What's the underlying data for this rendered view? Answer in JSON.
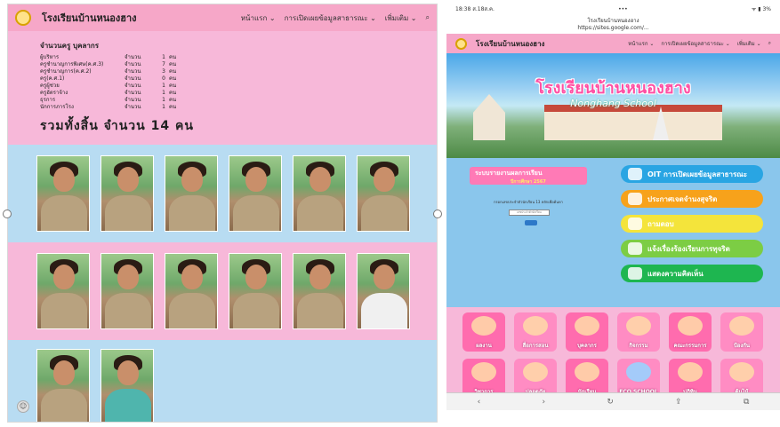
{
  "left": {
    "nav": {
      "title": "โรงเรียนบ้านหนองฮาง",
      "menu": [
        "หน้าแรก",
        "การเปิดเผยข้อมูลสาธารณะ",
        "เพิ่มเติม"
      ]
    },
    "staff": {
      "caption": "จำนวนครู บุคลากร",
      "rows": [
        {
          "role": "ผู้บริหาร",
          "label": "จำนวน",
          "count": "1",
          "unit": "คน"
        },
        {
          "role": "ครูชำนาญการพิเศษ(ค.ศ.3)",
          "label": "จำนวน",
          "count": "7",
          "unit": "คน"
        },
        {
          "role": "ครูชำนาญการ(ค.ศ.2)",
          "label": "จำนวน",
          "count": "3",
          "unit": "คน"
        },
        {
          "role": "ครู(ค.ศ.1)",
          "label": "จำนวน",
          "count": "0",
          "unit": "คน"
        },
        {
          "role": "ครูผู้ช่วย",
          "label": "จำนวน",
          "count": "1",
          "unit": "คน"
        },
        {
          "role": "ครูอัตราจ้าง",
          "label": "จำนวน",
          "count": "1",
          "unit": "คน"
        },
        {
          "role": "ธุรการ",
          "label": "จำนวน",
          "count": "1",
          "unit": "คน"
        },
        {
          "role": "นักการภารโรง",
          "label": "จำนวน",
          "count": "1",
          "unit": "คน"
        }
      ],
      "total": "รวมทั้งสิ้น  จำนวน  14  คน"
    },
    "photo_rows": [
      [
        "tan",
        "tan",
        "tan",
        "tan",
        "tan",
        "tan"
      ],
      [
        "tan",
        "tan",
        "tan",
        "tan",
        "tan",
        "white"
      ],
      [
        "tan",
        "teal"
      ]
    ]
  },
  "right": {
    "status": {
      "time": "18:38  ส.18ส.ค.",
      "dots": "•••",
      "battery": "ᯤ ▮ 3%"
    },
    "url": {
      "site": "โรงเรียนบ้านหนองฮาง",
      "address": "https://sites.google.com/..."
    },
    "nav": {
      "title": "โรงเรียนบ้านหนองฮาง",
      "menu": [
        "หน้าแรก",
        "การเปิดเผยข้อมูลสาธารณะ",
        "เพิ่มเติม"
      ]
    },
    "banner": {
      "title": "โรงเรียนบ้านหนองฮาง",
      "subtitle": "Nonghang School"
    },
    "report": {
      "title": "ระบบรายงานผลการเรียน",
      "sub": "ปีการศึกษา 2567"
    },
    "search_note": "กรอกเลขประจำตัวนักเรียน 13 หลักเพื่อค้นหา",
    "search_placeholder": "เลขประจำตัวนักเรียน",
    "pills": [
      {
        "label": "OIT การเปิดเผยข้อมูลสาธารณะ",
        "icon": "oit-icon"
      },
      {
        "label": "ประกาศเจตจำนงสุจริต",
        "icon": "announce-icon"
      },
      {
        "label": "ถามตอบ",
        "icon": "qa-icon"
      },
      {
        "label": "แจ้งเรื่องร้องเรียนการทุจริต",
        "icon": "report-icon"
      },
      {
        "label": "แสดงความคิดเห็น",
        "icon": "comment-icon"
      }
    ],
    "tiles": [
      {
        "label": "ผลงาน"
      },
      {
        "label": "สื่อการสอน"
      },
      {
        "label": "บุคลากร"
      },
      {
        "label": "กิจกรรม"
      },
      {
        "label": "คณะกรรมการ"
      },
      {
        "label": "ป้องกัน"
      },
      {
        "label": "วิชาการ"
      },
      {
        "label": "ปลอดภัย"
      },
      {
        "label": "นักเรียน"
      },
      {
        "label": "ECO SCHOOL"
      },
      {
        "label": "ปฏิทิน"
      },
      {
        "label": "ต้นไม้"
      }
    ]
  }
}
